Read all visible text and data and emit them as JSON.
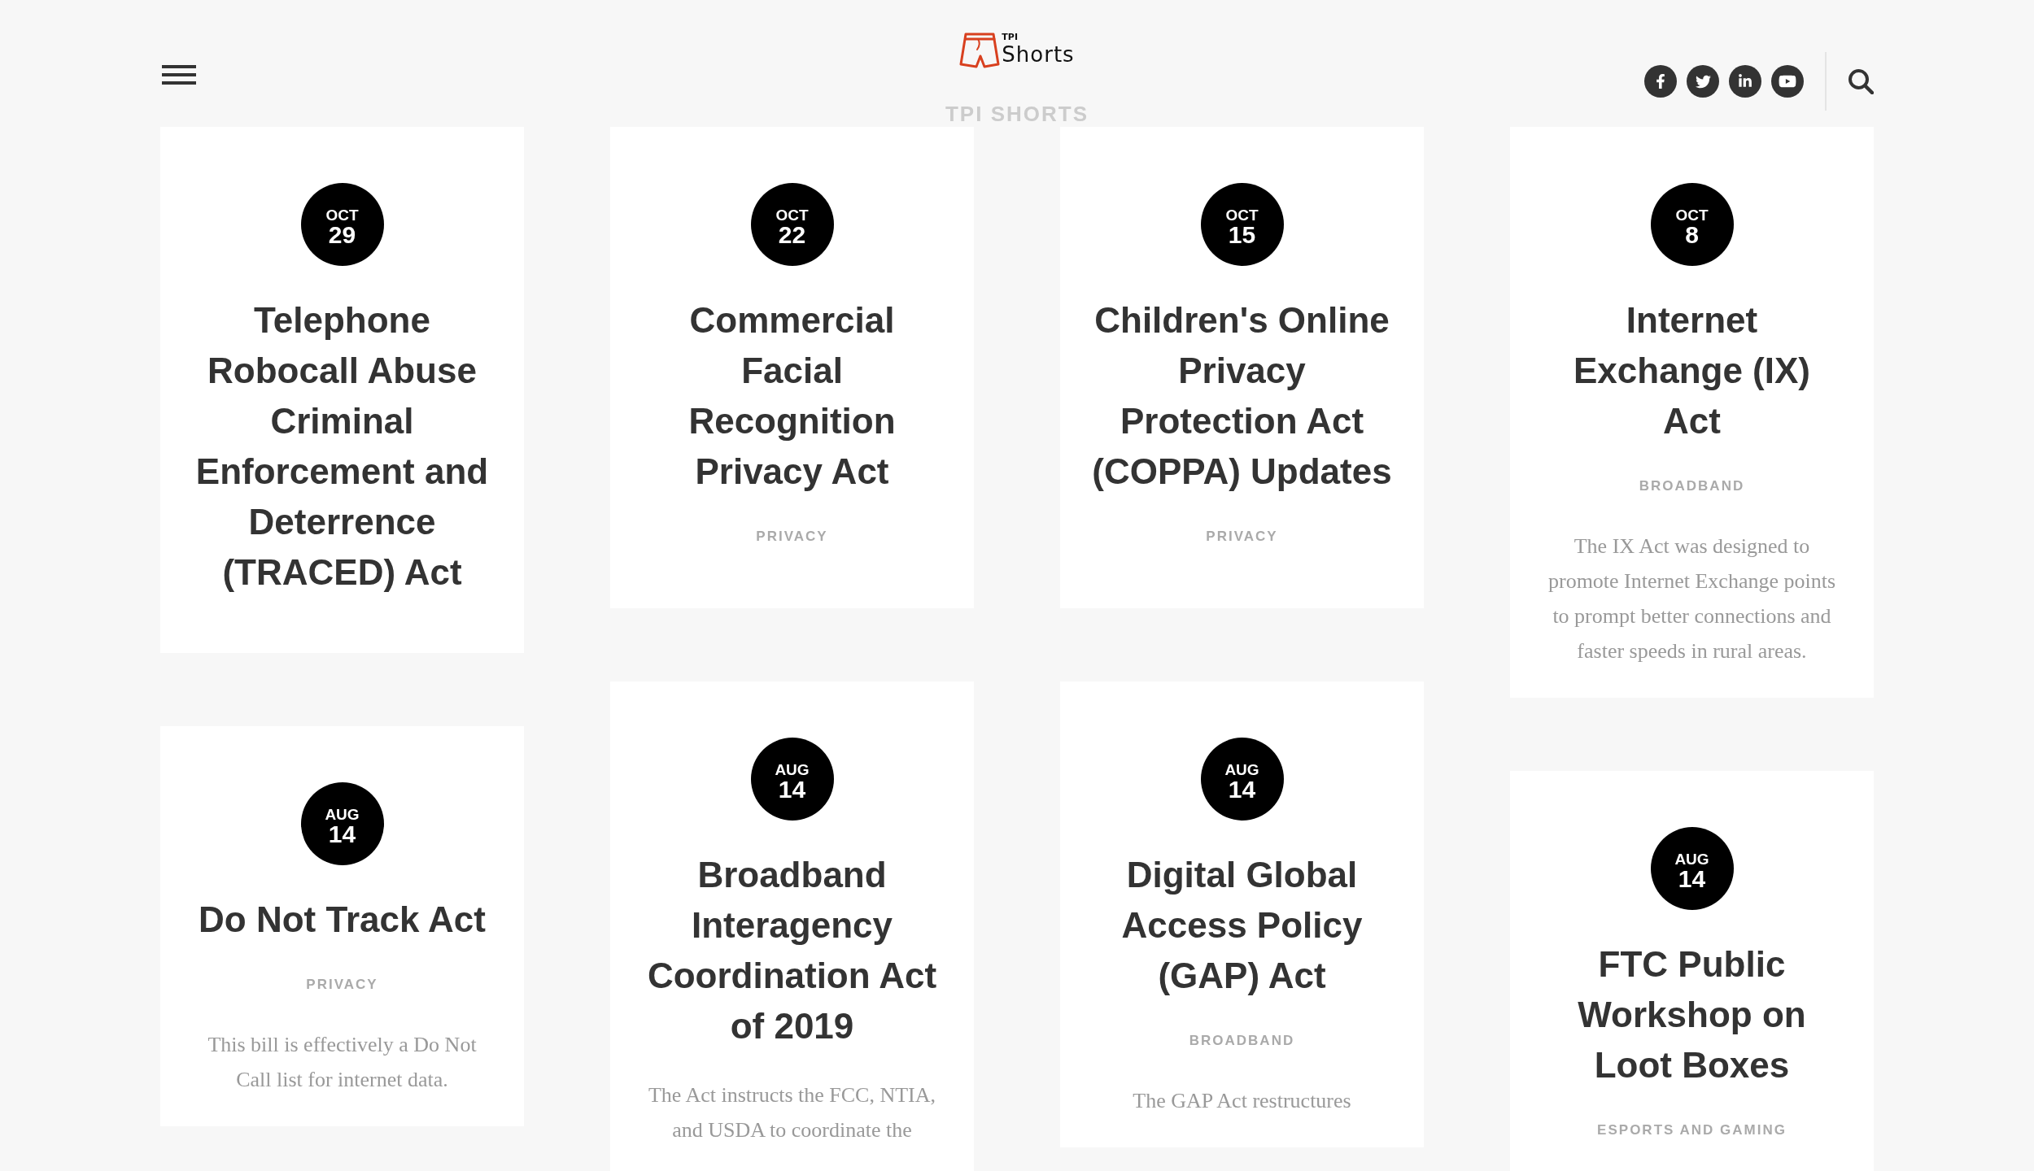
{
  "header": {
    "logo": {
      "small_text": "TPI",
      "text": "Shorts"
    },
    "page_title": "TPI SHORTS"
  },
  "posts": [
    {
      "month": "OCT",
      "day": "29",
      "title": "Telephone Robocall Abuse Criminal Enforcement and Deterrence (TRACED) Act"
    },
    {
      "month": "OCT",
      "day": "22",
      "title": "Commercial Facial Recognition Privacy Act",
      "category": "PRIVACY"
    },
    {
      "month": "OCT",
      "day": "15",
      "title": "Children's Online Privacy Protection Act (COPPA) Updates",
      "category": "PRIVACY"
    },
    {
      "month": "OCT",
      "day": "8",
      "title": "Internet Exchange (IX) Act",
      "category": "BROADBAND",
      "excerpt": "The IX Act was designed to promote Internet Exchange points to prompt better connections and faster speeds in rural areas."
    },
    {
      "month": "AUG",
      "day": "14",
      "title": "Do Not Track Act",
      "category": "PRIVACY",
      "excerpt": "This bill is effectively a Do Not Call list for internet data."
    },
    {
      "month": "AUG",
      "day": "14",
      "title": "Broadband Interagency Coordination Act of 2019",
      "excerpt": "The Act instructs the FCC, NTIA, and USDA to coordinate the"
    },
    {
      "month": "AUG",
      "day": "14",
      "title": "Digital Global Access Policy (GAP) Act",
      "category": "BROADBAND",
      "excerpt": "The GAP Act restructures"
    },
    {
      "month": "AUG",
      "day": "14",
      "title": "FTC Public Workshop on Loot Boxes",
      "category": "ESPORTS AND GAMING"
    }
  ]
}
